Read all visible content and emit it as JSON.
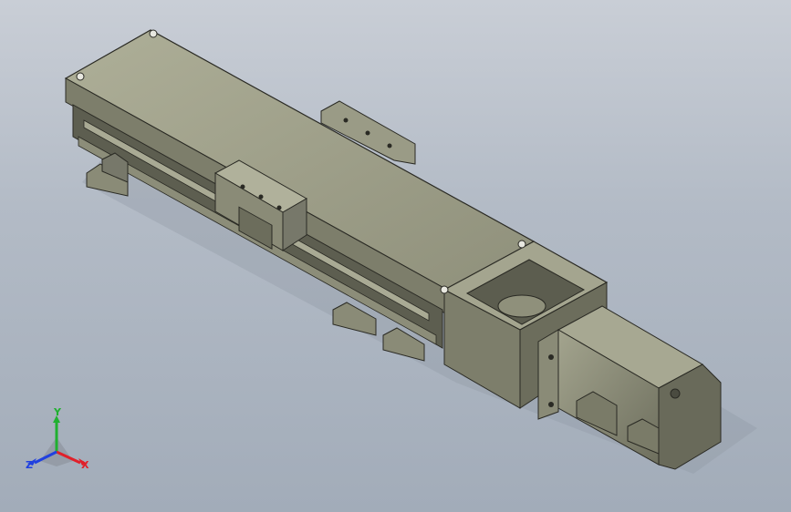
{
  "viewport": {
    "background_top": "#c9ced6",
    "background_bottom": "#a2acb9"
  },
  "model": {
    "body_color": "#9a9b86",
    "body_light": "#b4b59f",
    "body_dark": "#6c6d5c",
    "edge_color": "#2a2a24"
  },
  "triad": {
    "x_label": "X",
    "y_label": "Y",
    "z_label": "Z",
    "x_color": "#e0202a",
    "y_color": "#20b030",
    "z_color": "#2040e0"
  }
}
